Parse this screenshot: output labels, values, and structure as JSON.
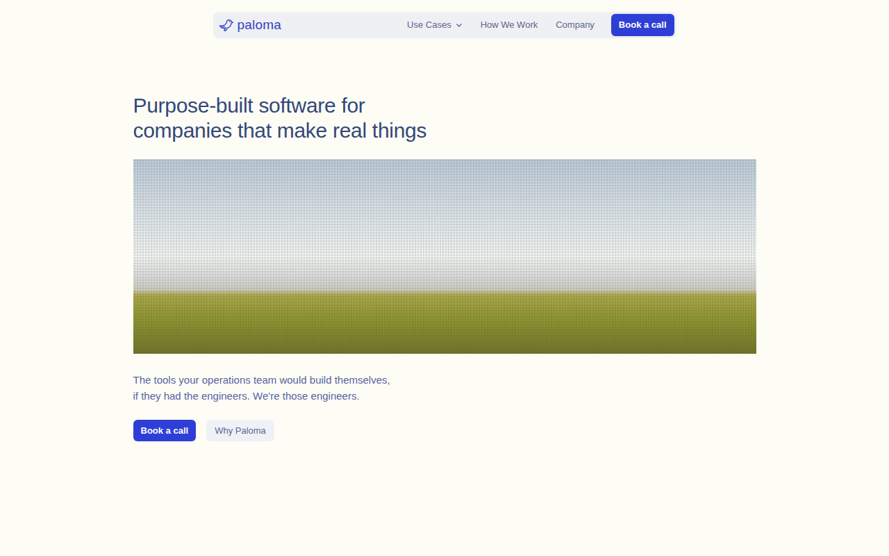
{
  "nav": {
    "logo": "paloma",
    "links": [
      {
        "label": "Use Cases",
        "kind": "dropdown"
      },
      {
        "label": "How We Work",
        "kind": "link"
      },
      {
        "label": "Company",
        "kind": "link"
      }
    ],
    "cta": "Book a call"
  },
  "hero": {
    "title_lines": [
      "Purpose-built software for",
      "companies that make real things"
    ],
    "subtitle_lines": [
      "The tools your operations team would build themselves,",
      "if they had the engineers. We're those engineers."
    ],
    "buttons": [
      {
        "label": "Book a call",
        "kind": "primary"
      },
      {
        "label": "Why Paloma",
        "kind": "secondary"
      }
    ]
  }
}
